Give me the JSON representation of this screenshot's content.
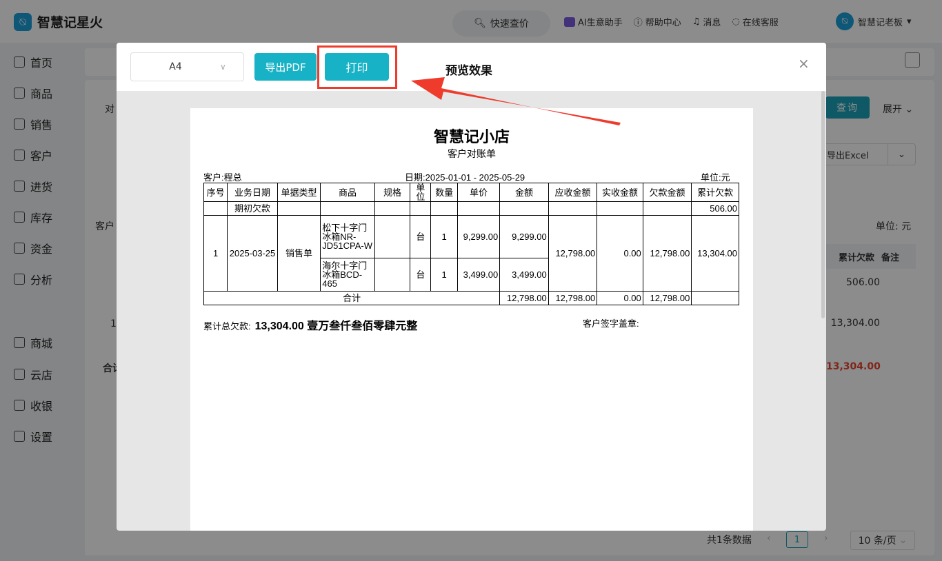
{
  "app": {
    "logo_glyph": "⍉",
    "name": "智慧记星火"
  },
  "topbar": {
    "quick_search": "快速查价",
    "ai_assistant": "AI生意助手",
    "help": "帮助中心",
    "messages": "消息",
    "support": "在线客服",
    "user_name": "智慧记老板"
  },
  "sidebar": {
    "items": [
      {
        "label": "首页",
        "icon": "home-icon"
      },
      {
        "label": "商品",
        "icon": "bag-icon"
      },
      {
        "label": "销售",
        "icon": "receipt-icon"
      },
      {
        "label": "客户",
        "icon": "user-icon"
      },
      {
        "label": "进货",
        "icon": "box-icon"
      },
      {
        "label": "库存",
        "icon": "warehouse-icon"
      },
      {
        "label": "资金",
        "icon": "wallet-icon"
      },
      {
        "label": "分析",
        "icon": "chart-icon"
      },
      {
        "label": "商城",
        "icon": "store-icon"
      },
      {
        "label": "云店",
        "icon": "cloud-store-icon"
      },
      {
        "label": "收银",
        "icon": "cashier-icon"
      },
      {
        "label": "设置",
        "icon": "gear-icon"
      }
    ]
  },
  "background": {
    "query_button": "查询",
    "expand": "展开",
    "export_excel": "导出Excel",
    "unit": "单位: 元",
    "col_cumulative": "累计欠款",
    "col_note": "备注",
    "row1_value": "506.00",
    "row2_value": "13,304.00",
    "total_value": "13,304.00",
    "left_dui": "对",
    "left_kehu": "客户",
    "left_one": "1",
    "left_total": "合计",
    "pager_count": "共1条数据",
    "pager_current": "1",
    "pager_size": "10 条/页"
  },
  "modal": {
    "paper_size": "A4",
    "export_pdf": "导出PDF",
    "print": "打印",
    "preview_label": "预览效果",
    "close": "×"
  },
  "statement": {
    "shop_name": "智慧记小店",
    "title": "客户对账单",
    "customer": "客户:程总",
    "date_range": "日期:2025-01-01 - 2025-05-29",
    "unit": "单位:元",
    "headers": [
      "序号",
      "业务日期",
      "单据类型",
      "商品",
      "规格",
      "单位",
      "数量",
      "单价",
      "金额",
      "应收金额",
      "实收金额",
      "欠款金额",
      "累计欠款"
    ],
    "opening_label": "期初欠款",
    "opening_cumulative": "506.00",
    "row": {
      "no": "1",
      "date": "2025-03-25",
      "type": "销售单",
      "receivable": "12,798.00",
      "received": "0.00",
      "owed": "12,798.00",
      "cumulative": "13,304.00"
    },
    "items": [
      {
        "product": "松下十字门冰箱NR-JD51CPA-W",
        "unit": "台",
        "qty": "1",
        "price": "9,299.00",
        "amount": "9,299.00"
      },
      {
        "product": "海尔十字门冰箱BCD-465",
        "unit": "台",
        "qty": "1",
        "price": "3,499.00",
        "amount": "3,499.00"
      }
    ],
    "total_label": "合计",
    "total_amount": "12,798.00",
    "total_receivable": "12,798.00",
    "total_received": "0.00",
    "total_owed": "12,798.00",
    "total_debt_label": "累计总欠款:",
    "total_debt_value": "13,304.00 壹万叁仟叁佰零肆元整",
    "signature_label": "客户签字盖章:"
  },
  "colors": {
    "accent": "#18b2c6",
    "highlight": "#ee3b2c",
    "danger_text": "#e8452f"
  }
}
